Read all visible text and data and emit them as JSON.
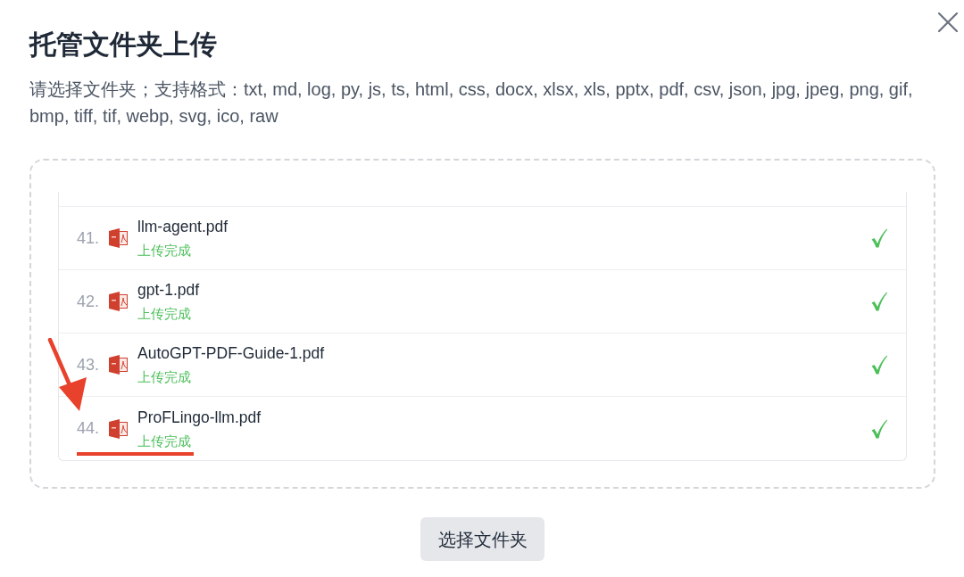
{
  "dialog": {
    "title": "托管文件夹上传",
    "description": "请选择文件夹；支持格式：txt, md, log, py, js, ts, html, css, docx, xlsx, xls, pptx, pdf, csv, json, jpg, jpeg, png, gif, bmp, tiff, tif, webp, svg, ico, raw"
  },
  "file_list": {
    "items": [
      {
        "index": "41.",
        "name": "llm-agent.pdf",
        "status": "上传完成",
        "done": true
      },
      {
        "index": "42.",
        "name": "gpt-1.pdf",
        "status": "上传完成",
        "done": true
      },
      {
        "index": "43.",
        "name": "AutoGPT-PDF-Guide-1.pdf",
        "status": "上传完成",
        "done": true
      },
      {
        "index": "44.",
        "name": "ProFLingo-llm.pdf",
        "status": "上传完成",
        "done": true
      }
    ]
  },
  "button": "选择文件夹"
}
